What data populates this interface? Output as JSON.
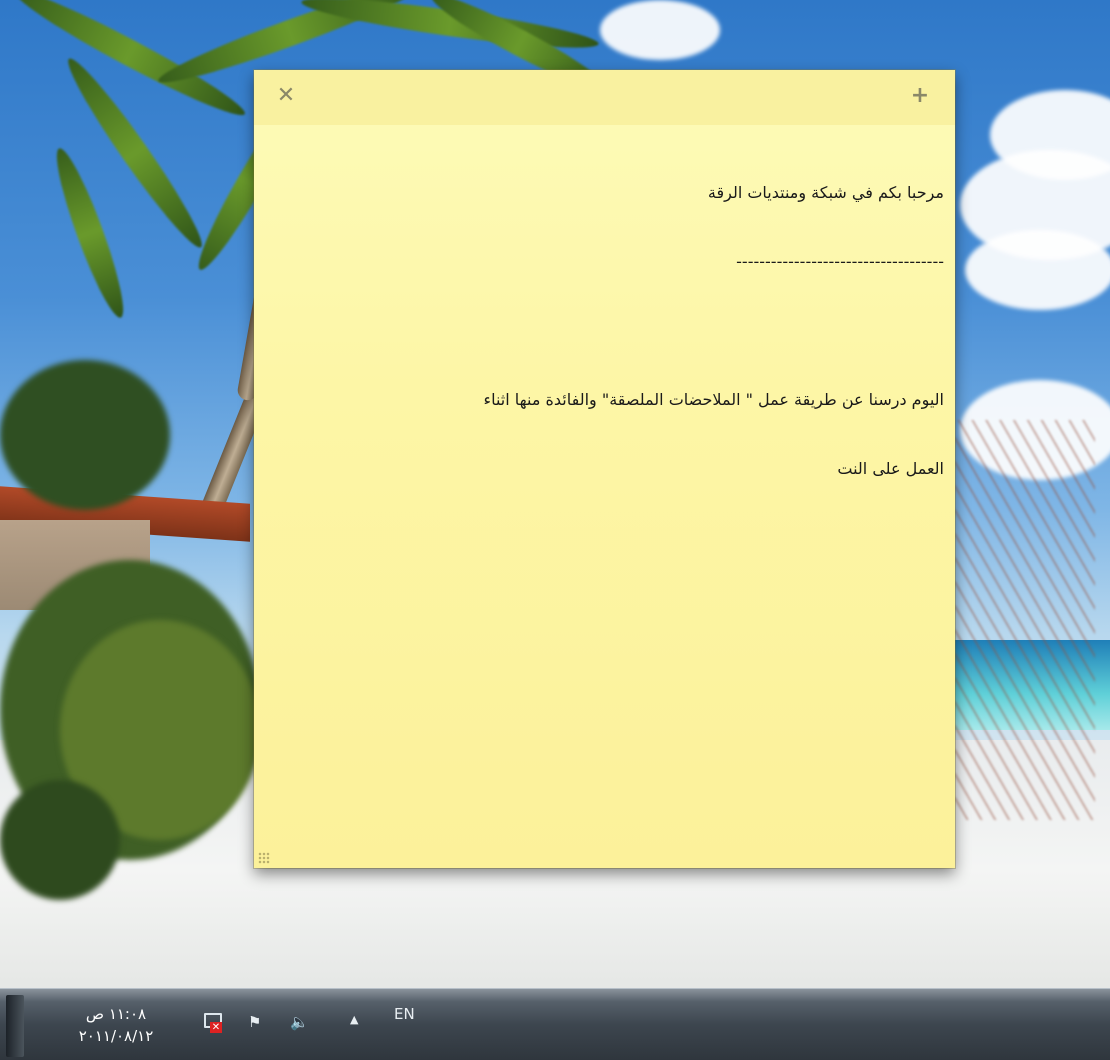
{
  "note": {
    "close_icon": "✕",
    "add_icon": "+",
    "lines": [
      "مرحبا بكم في شبكة ومنتديات الرقة",
      "------------------------------------",
      "",
      "اليوم درسنا عن طريقة عمل \" الملاحضات الملصقة\" والفائدة منها اثناء",
      "العمل على النت"
    ],
    "background_color": "#fdf6a6"
  },
  "taskbar": {
    "clock": {
      "time": "١١:٠٨ ص",
      "date": "٢٠١١/٠٨/١٢"
    },
    "tray_icons": [
      "network-icon",
      "flag-icon",
      "volume-icon",
      "tray-expand-icon"
    ],
    "flag_glyph": "⚑",
    "volume_glyph": "🔈",
    "expand_glyph": "▲",
    "language": "EN"
  }
}
